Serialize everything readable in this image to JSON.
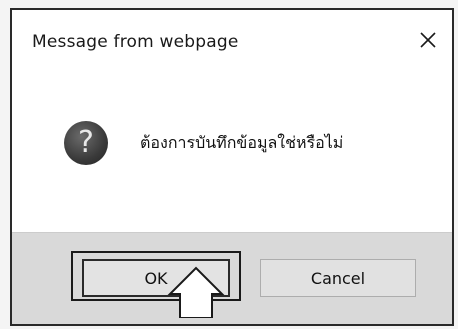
{
  "dialog": {
    "title": "Message from webpage",
    "close_icon": "close-icon",
    "message": "ต้องการบันทึกข้อมูลใช่หรือไม่",
    "question_icon_glyph": "?",
    "buttons": {
      "ok_label": "OK",
      "cancel_label": "Cancel"
    }
  },
  "colors": {
    "dialog_background": "#ffffff",
    "footer_background": "#d9d9d9",
    "button_face": "#e1e1e1",
    "icon_dark": "#3a3a3a"
  }
}
